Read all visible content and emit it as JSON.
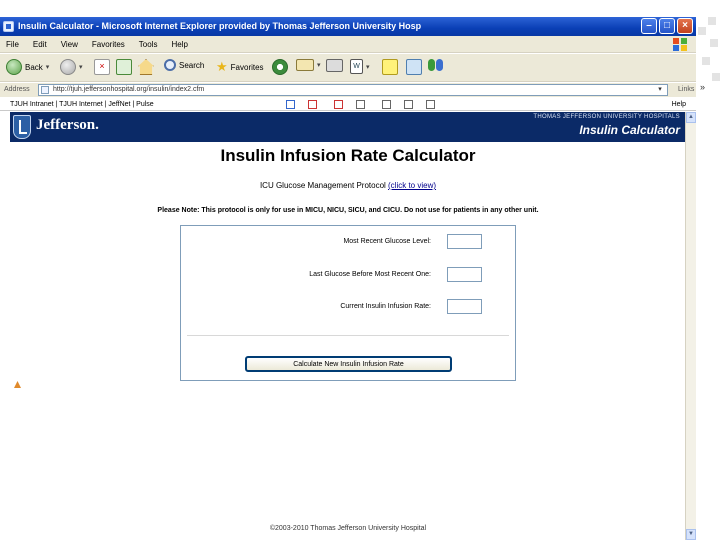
{
  "window": {
    "title": "Insulin Calculator - Microsoft Internet Explorer provided by Thomas Jefferson University Hosp"
  },
  "menu": [
    "File",
    "Edit",
    "View",
    "Favorites",
    "Tools",
    "Help"
  ],
  "toolbar": {
    "back_label": "Back",
    "search_label": "Search",
    "favorites_label": "Favorites"
  },
  "address": {
    "label": "Address",
    "url": "http://tjuh.jeffersonhospital.org/insulin/index2.cfm",
    "links_label": "Links"
  },
  "links_bar": {
    "items": "TJUH Intranet | TJUH Internet | JeffNet | Pulse",
    "help": "Help"
  },
  "banner": {
    "brand": "Jefferson.",
    "org": "THOMAS JEFFERSON UNIVERSITY HOSPITALS",
    "app_title": "Insulin Calculator"
  },
  "content": {
    "heading": "Insulin Infusion Rate Calculator",
    "protocol_prefix": "ICU Glucose Management Protocol ",
    "protocol_link": "(click to view)",
    "note": "Please Note: This protocol is only for use in MICU, NICU, SICU, and CICU. Do not use for patients in any other unit.",
    "fields": [
      {
        "label": "Most Recent Glucose Level:",
        "value": ""
      },
      {
        "label": "Last Glucose Before Most Recent One:",
        "value": ""
      },
      {
        "label": "Current Insulin Infusion Rate:",
        "value": ""
      }
    ],
    "calculate_button": "Calculate New Insulin Infusion Rate"
  },
  "footer": "©2003-2010 Thomas Jefferson University Hospital"
}
